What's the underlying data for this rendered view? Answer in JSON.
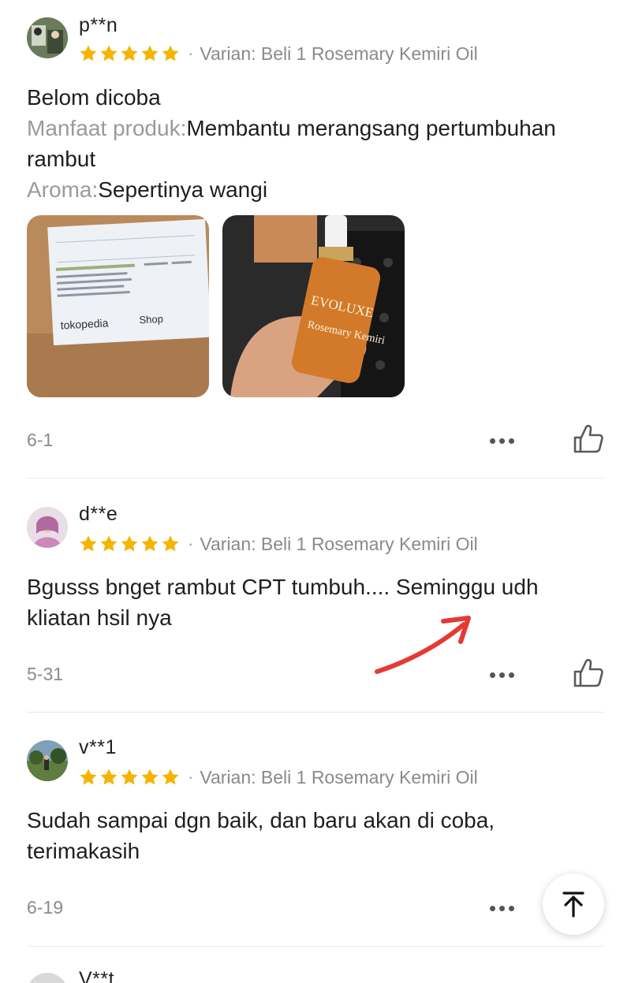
{
  "reviews": [
    {
      "username": "p**n",
      "rating": 5,
      "variant_label": "Varian:",
      "variant_value": "Beli 1 Rosemary Kemiri Oil",
      "text": "Belom dicoba",
      "details": [
        {
          "key": "Manfaat produk:",
          "value": "Membantu merangsang pertumbuhan rambut"
        },
        {
          "key": "Aroma:",
          "value": "Sepertinya wangi"
        }
      ],
      "photos": [
        {
          "label_brand": "tokopedia",
          "label_shop": "Shop"
        },
        {
          "product_brand": "EVOLUXE",
          "product_name": "Rosemary Kemiri"
        }
      ],
      "date": "6-1"
    },
    {
      "username": "d**e",
      "rating": 5,
      "variant_label": "Varian:",
      "variant_value": "Beli 1 Rosemary Kemiri Oil",
      "text": "Bgusss bnget rambut CPT tumbuh.... Seminggu udh kliatan hsil nya",
      "date": "5-31"
    },
    {
      "username": "v**1",
      "rating": 5,
      "variant_label": "Varian:",
      "variant_value": "Beli 1 Rosemary Kemiri Oil",
      "text": "Sudah sampai dgn baik, dan baru akan di coba, terimakasih",
      "date": "6-19"
    },
    {
      "username": "V**t"
    }
  ],
  "colors": {
    "star": "#F5B400",
    "muted_text": "#8A8A8A",
    "annotation_arrow": "#E53935"
  },
  "icons": {
    "more": "more-dots-icon",
    "like": "thumbs-up-icon",
    "scroll_top": "arrow-up-to-top-icon"
  }
}
